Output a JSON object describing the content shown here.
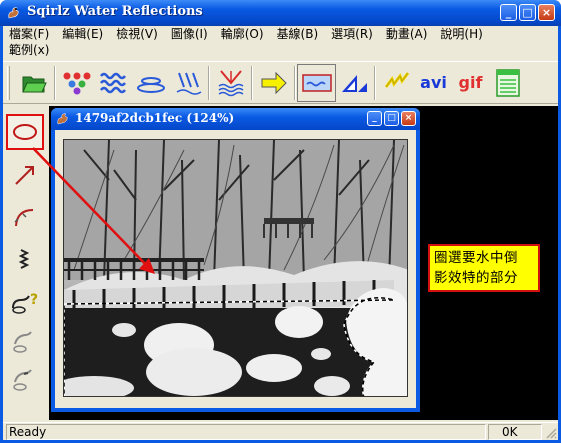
{
  "app": {
    "title": "Sqirlz Water Reflections"
  },
  "window_controls": {
    "minimize": "_",
    "maximize": "□",
    "close": "×"
  },
  "menubar": {
    "row1": [
      "檔案(F)",
      "編輯(E)",
      "檢視(V)",
      "圖像(I)",
      "輪廓(O)",
      "基線(B)",
      "選項(R)",
      "動畫(A)",
      "說明(H)"
    ],
    "row2": [
      "範例(x)"
    ]
  },
  "toolbar": {
    "tools": [
      "open-folder",
      "color-dots",
      "waves",
      "ripples",
      "rain",
      "reflection",
      "arrow-right",
      "water-rect",
      "triangles",
      "lightning",
      "avi",
      "gif",
      "settings-panel"
    ],
    "avi_label": "avi",
    "gif_label": "gif"
  },
  "palette": {
    "tools": [
      "ellipse-select",
      "arrow-line",
      "curve",
      "zigzag",
      "curve-question",
      "curve-2",
      "curve-3"
    ]
  },
  "child_window": {
    "title": "1479af2dcb1fec  (124%)"
  },
  "callout": {
    "line1": "圈選要水中倒",
    "line2": "影效特的部分",
    "color": "#ffff00",
    "border_color": "#d01010"
  },
  "statusbar": {
    "left": "Ready",
    "right": "0K"
  },
  "colors": {
    "title_blue": "#0a5ae3",
    "face": "#ece9d8",
    "highlight_red": "#e01010"
  }
}
